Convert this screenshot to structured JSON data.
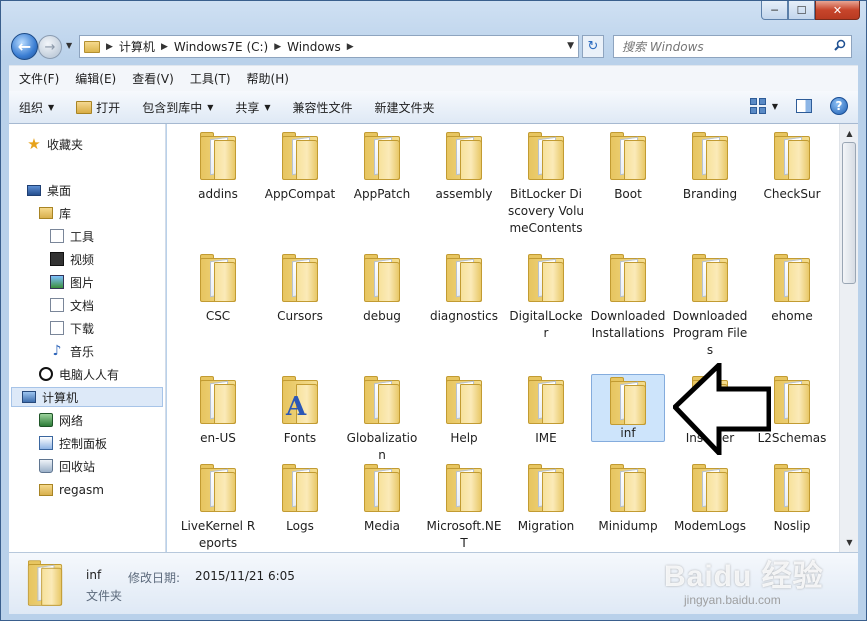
{
  "window": {
    "minimize": "─",
    "maximize": "☐",
    "close": "✕"
  },
  "address": {
    "crumbs": [
      "计算机",
      "Windows7E (C:)",
      "Windows"
    ],
    "search_placeholder": "搜索 Windows"
  },
  "menu": [
    "文件(F)",
    "编辑(E)",
    "查看(V)",
    "工具(T)",
    "帮助(H)"
  ],
  "toolbar": {
    "organize": "组织",
    "open": "打开",
    "include_in_library": "包含到库中",
    "share": "共享",
    "compat_files": "兼容性文件",
    "new_folder": "新建文件夹"
  },
  "nav": {
    "favorites": "收藏夹",
    "desktop": "桌面",
    "libraries": "库",
    "tools": "工具",
    "videos": "视频",
    "pictures": "图片",
    "documents": "文档",
    "downloads": "下载",
    "music": "音乐",
    "user": "电脑人人有",
    "computer": "计算机",
    "network": "网络",
    "control_panel": "控制面板",
    "recycle_bin": "回收站",
    "regasm": "regasm"
  },
  "folders": [
    {
      "name": "addins"
    },
    {
      "name": "AppCompat"
    },
    {
      "name": "AppPatch"
    },
    {
      "name": "assembly"
    },
    {
      "name": "BitLocker Discovery VolumeContents"
    },
    {
      "name": "Boot"
    },
    {
      "name": "Branding"
    },
    {
      "name": "CheckSur"
    },
    {
      "name": "CSC"
    },
    {
      "name": "Cursors"
    },
    {
      "name": "debug"
    },
    {
      "name": "diagnostics"
    },
    {
      "name": "DigitalLocker"
    },
    {
      "name": "Downloaded Installations"
    },
    {
      "name": "Downloaded Program Files"
    },
    {
      "name": "ehome"
    },
    {
      "name": "en-US"
    },
    {
      "name": "Fonts"
    },
    {
      "name": "Globalization"
    },
    {
      "name": "Help"
    },
    {
      "name": "IME"
    },
    {
      "name": "inf"
    },
    {
      "name": "Installer"
    },
    {
      "name": "L2Schemas"
    },
    {
      "name": "LiveKernel Reports"
    },
    {
      "name": "Logs"
    },
    {
      "name": "Media"
    },
    {
      "name": "Microsoft.NET"
    },
    {
      "name": "Migration"
    },
    {
      "name": "Minidump"
    },
    {
      "name": "ModemLogs"
    },
    {
      "name": "Noslip"
    }
  ],
  "details": {
    "name": "inf",
    "modified_label": "修改日期:",
    "modified_value": "2015/11/21 6:05",
    "type": "文件夹"
  },
  "watermark": {
    "brand": "Baidu 经验",
    "url": "jingyan.baidu.com"
  }
}
